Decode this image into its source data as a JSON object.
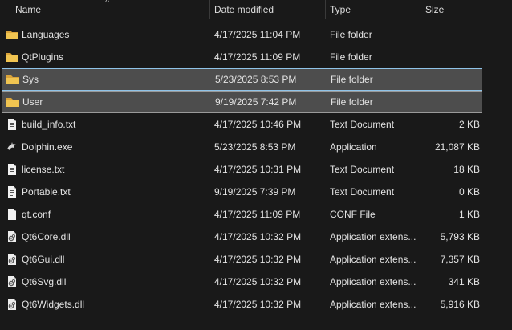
{
  "columns": {
    "name": "Name",
    "date": "Date modified",
    "type": "Type",
    "size": "Size"
  },
  "sort_caret": "^",
  "files": [
    {
      "name": "Languages",
      "date": "4/17/2025 11:04 PM",
      "type": "File folder",
      "size": "",
      "icon": "folder-icon",
      "state": ""
    },
    {
      "name": "QtPlugins",
      "date": "4/17/2025 11:09 PM",
      "type": "File folder",
      "size": "",
      "icon": "folder-icon",
      "state": ""
    },
    {
      "name": "Sys",
      "date": "5/23/2025 8:53 PM",
      "type": "File folder",
      "size": "",
      "icon": "folder-icon",
      "state": "focused"
    },
    {
      "name": "User",
      "date": "9/19/2025 7:42 PM",
      "type": "File folder",
      "size": "",
      "icon": "folder-icon",
      "state": "selected"
    },
    {
      "name": "build_info.txt",
      "date": "4/17/2025 10:46 PM",
      "type": "Text Document",
      "size": "2 KB",
      "icon": "text-file-icon",
      "state": ""
    },
    {
      "name": "Dolphin.exe",
      "date": "5/23/2025 8:53 PM",
      "type": "Application",
      "size": "21,087 KB",
      "icon": "dolphin-app-icon",
      "state": ""
    },
    {
      "name": "license.txt",
      "date": "4/17/2025 10:31 PM",
      "type": "Text Document",
      "size": "18 KB",
      "icon": "text-file-icon",
      "state": ""
    },
    {
      "name": "Portable.txt",
      "date": "9/19/2025 7:39 PM",
      "type": "Text Document",
      "size": "0 KB",
      "icon": "text-file-icon",
      "state": ""
    },
    {
      "name": "qt.conf",
      "date": "4/17/2025 11:09 PM",
      "type": "CONF File",
      "size": "1 KB",
      "icon": "blank-file-icon",
      "state": ""
    },
    {
      "name": "Qt6Core.dll",
      "date": "4/17/2025 10:32 PM",
      "type": "Application extens...",
      "size": "5,793 KB",
      "icon": "dll-file-icon",
      "state": ""
    },
    {
      "name": "Qt6Gui.dll",
      "date": "4/17/2025 10:32 PM",
      "type": "Application extens...",
      "size": "7,357 KB",
      "icon": "dll-file-icon",
      "state": ""
    },
    {
      "name": "Qt6Svg.dll",
      "date": "4/17/2025 10:32 PM",
      "type": "Application extens...",
      "size": "341 KB",
      "icon": "dll-file-icon",
      "state": ""
    },
    {
      "name": "Qt6Widgets.dll",
      "date": "4/17/2025 10:32 PM",
      "type": "Application extens...",
      "size": "5,916 KB",
      "icon": "dll-file-icon",
      "state": ""
    }
  ],
  "colors": {
    "background": "#191919",
    "selected_row": "#4d4d4d",
    "focus_border": "#8fc3e8",
    "folder": "#e8b64a"
  }
}
